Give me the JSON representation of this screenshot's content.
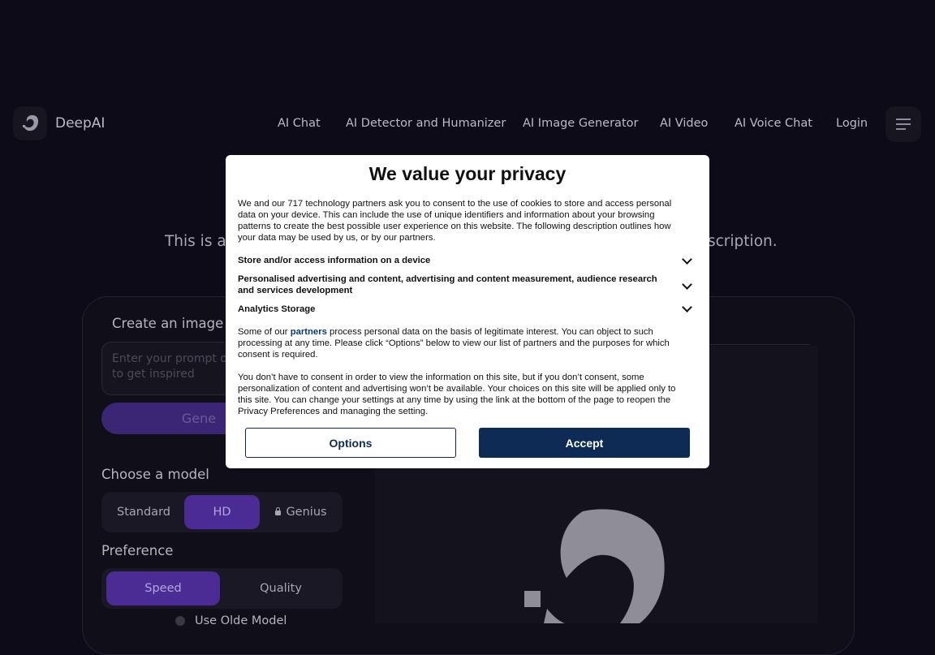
{
  "header": {
    "brand": "DeepAI",
    "nav": [
      "AI Chat",
      "AI Detector and Humanizer",
      "AI Image Generator",
      "AI Video",
      "AI Voice Chat",
      "Login"
    ]
  },
  "hero": {
    "tagline_left": "This is a",
    "tagline_right": "scription."
  },
  "generator": {
    "create_label": "Create an image fr",
    "prompt_placeholder": "Enter your prompt or\nto get inspired",
    "generate_label": "Gene",
    "model_label": "Choose a model",
    "models": [
      "Standard",
      "HD",
      "Genius"
    ],
    "active_model": "HD",
    "preference_label": "Preference",
    "preferences": [
      "Speed",
      "Quality"
    ],
    "active_preference": "Speed",
    "olde_label": "Use Olde Model"
  },
  "consent": {
    "title": "We value your privacy",
    "intro": "We and our 717 technology partners ask you to consent to the use of cookies to store and access personal data on your device. This can include the use of unique identifiers and information about your browsing patterns to create the best possible user experience on this website. The following description outlines how your data may be used by us, or by our partners.",
    "purposes": [
      "Store and/or access information on a device",
      "Personalised advertising and content, advertising and content measurement, audience research and services development",
      "Analytics Storage"
    ],
    "legit_prefix": "Some of our",
    "legit_link": "partners",
    "legit_suffix": "process personal data on the basis of legitimate interest. You can object to such processing at any time. Please click “Options” below to view our list of partners and the purposes for which consent is required.",
    "notice": "You don’t have to consent in order to view the information on this site, but if you don’t consent, some personalization of content and advertising won’t be available. Your choices on this site will be applied only to this site. You can change your settings at any time by using the link at the bottom of the page to reopen the Privacy Preferences and managing the setting.",
    "options_label": "Options",
    "accept_label": "Accept"
  }
}
